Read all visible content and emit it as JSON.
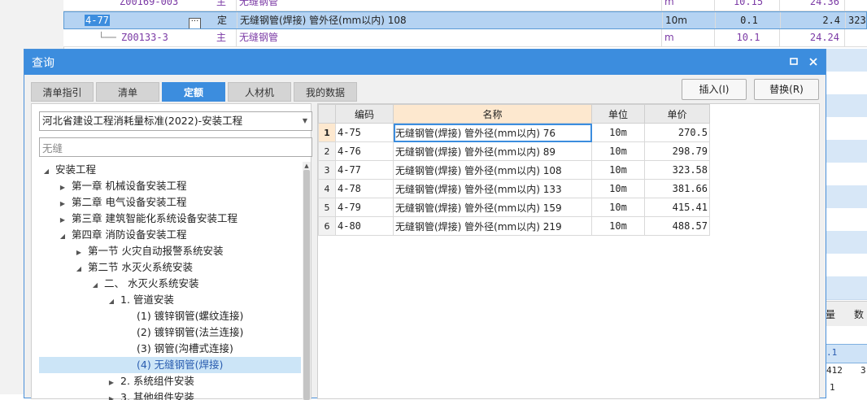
{
  "background": {
    "rows": [
      {
        "code": "Z00169-003",
        "type": "主",
        "name": "无缝钢管",
        "unit": "m",
        "qty": "10.15",
        "amount": "24.36",
        "extra": ""
      },
      {
        "code": "4-77",
        "type": "定",
        "name": "无缝钢管(焊接) 管外径(mm以内) 108",
        "unit": "10m",
        "qty": "0.1",
        "amount": "2.4",
        "extra": "323"
      },
      {
        "code": "Z00133-3",
        "type": "主",
        "name": "无缝钢管",
        "unit": "m",
        "qty": "10.1",
        "amount": "24.24",
        "extra": ""
      }
    ],
    "right_header": [
      "量",
      "数"
    ],
    "right_values": [
      ".1",
      "412",
      "1",
      "3"
    ]
  },
  "dialog": {
    "title": "查询",
    "maximize_icon": "maximize-icon",
    "close_icon": "close-icon",
    "tabs": [
      "清单指引",
      "清单",
      "定额",
      "人材机",
      "我的数据"
    ],
    "active_tab": "定额",
    "insert_button": "插入(I)",
    "replace_button": "替换(R)",
    "quota_library": "河北省建设工程消耗量标准(2022)-安装工程",
    "search_value": "无缝",
    "tree": [
      {
        "label": "安装工程",
        "depth": 0,
        "toggle": "expanded"
      },
      {
        "label": "第一章 机械设备安装工程",
        "depth": 1,
        "toggle": "collapsed"
      },
      {
        "label": "第二章 电气设备安装工程",
        "depth": 1,
        "toggle": "collapsed"
      },
      {
        "label": "第三章 建筑智能化系统设备安装工程",
        "depth": 1,
        "toggle": "collapsed"
      },
      {
        "label": "第四章 消防设备安装工程",
        "depth": 1,
        "toggle": "expanded"
      },
      {
        "label": "第一节 火灾自动报警系统安装",
        "depth": 2,
        "toggle": "collapsed"
      },
      {
        "label": "第二节 水灭火系统安装",
        "depth": 2,
        "toggle": "expanded"
      },
      {
        "label": "二、 水灭火系统安装",
        "depth": 3,
        "toggle": "expanded"
      },
      {
        "label": "1. 管道安装",
        "depth": 4,
        "toggle": "expanded"
      },
      {
        "label": "(1) 镀锌钢管(螺纹连接)",
        "depth": 5,
        "toggle": "none"
      },
      {
        "label": "(2) 镀锌钢管(法兰连接)",
        "depth": 5,
        "toggle": "none"
      },
      {
        "label": "(3) 钢管(沟槽式连接)",
        "depth": 5,
        "toggle": "none"
      },
      {
        "label": "(4) 无缝钢管(焊接)",
        "depth": 5,
        "toggle": "none",
        "selected": true
      },
      {
        "label": "2. 系统组件安装",
        "depth": 4,
        "toggle": "collapsed"
      },
      {
        "label": "3. 其他组件安装",
        "depth": 4,
        "toggle": "collapsed"
      }
    ],
    "table": {
      "headers": [
        "编码",
        "名称",
        "单位",
        "单价"
      ],
      "rows": [
        {
          "num": "1",
          "code": "4-75",
          "name": "无缝钢管(焊接) 管外径(mm以内) 76",
          "unit": "10m",
          "price": "270.5"
        },
        {
          "num": "2",
          "code": "4-76",
          "name": "无缝钢管(焊接) 管外径(mm以内) 89",
          "unit": "10m",
          "price": "298.79"
        },
        {
          "num": "3",
          "code": "4-77",
          "name": "无缝钢管(焊接) 管外径(mm以内) 108",
          "unit": "10m",
          "price": "323.58"
        },
        {
          "num": "4",
          "code": "4-78",
          "name": "无缝钢管(焊接) 管外径(mm以内) 133",
          "unit": "10m",
          "price": "381.66"
        },
        {
          "num": "5",
          "code": "4-79",
          "name": "无缝钢管(焊接) 管外径(mm以内) 159",
          "unit": "10m",
          "price": "415.41"
        },
        {
          "num": "6",
          "code": "4-80",
          "name": "无缝钢管(焊接) 管外径(mm以内) 219",
          "unit": "10m",
          "price": "488.57"
        }
      ]
    }
  }
}
